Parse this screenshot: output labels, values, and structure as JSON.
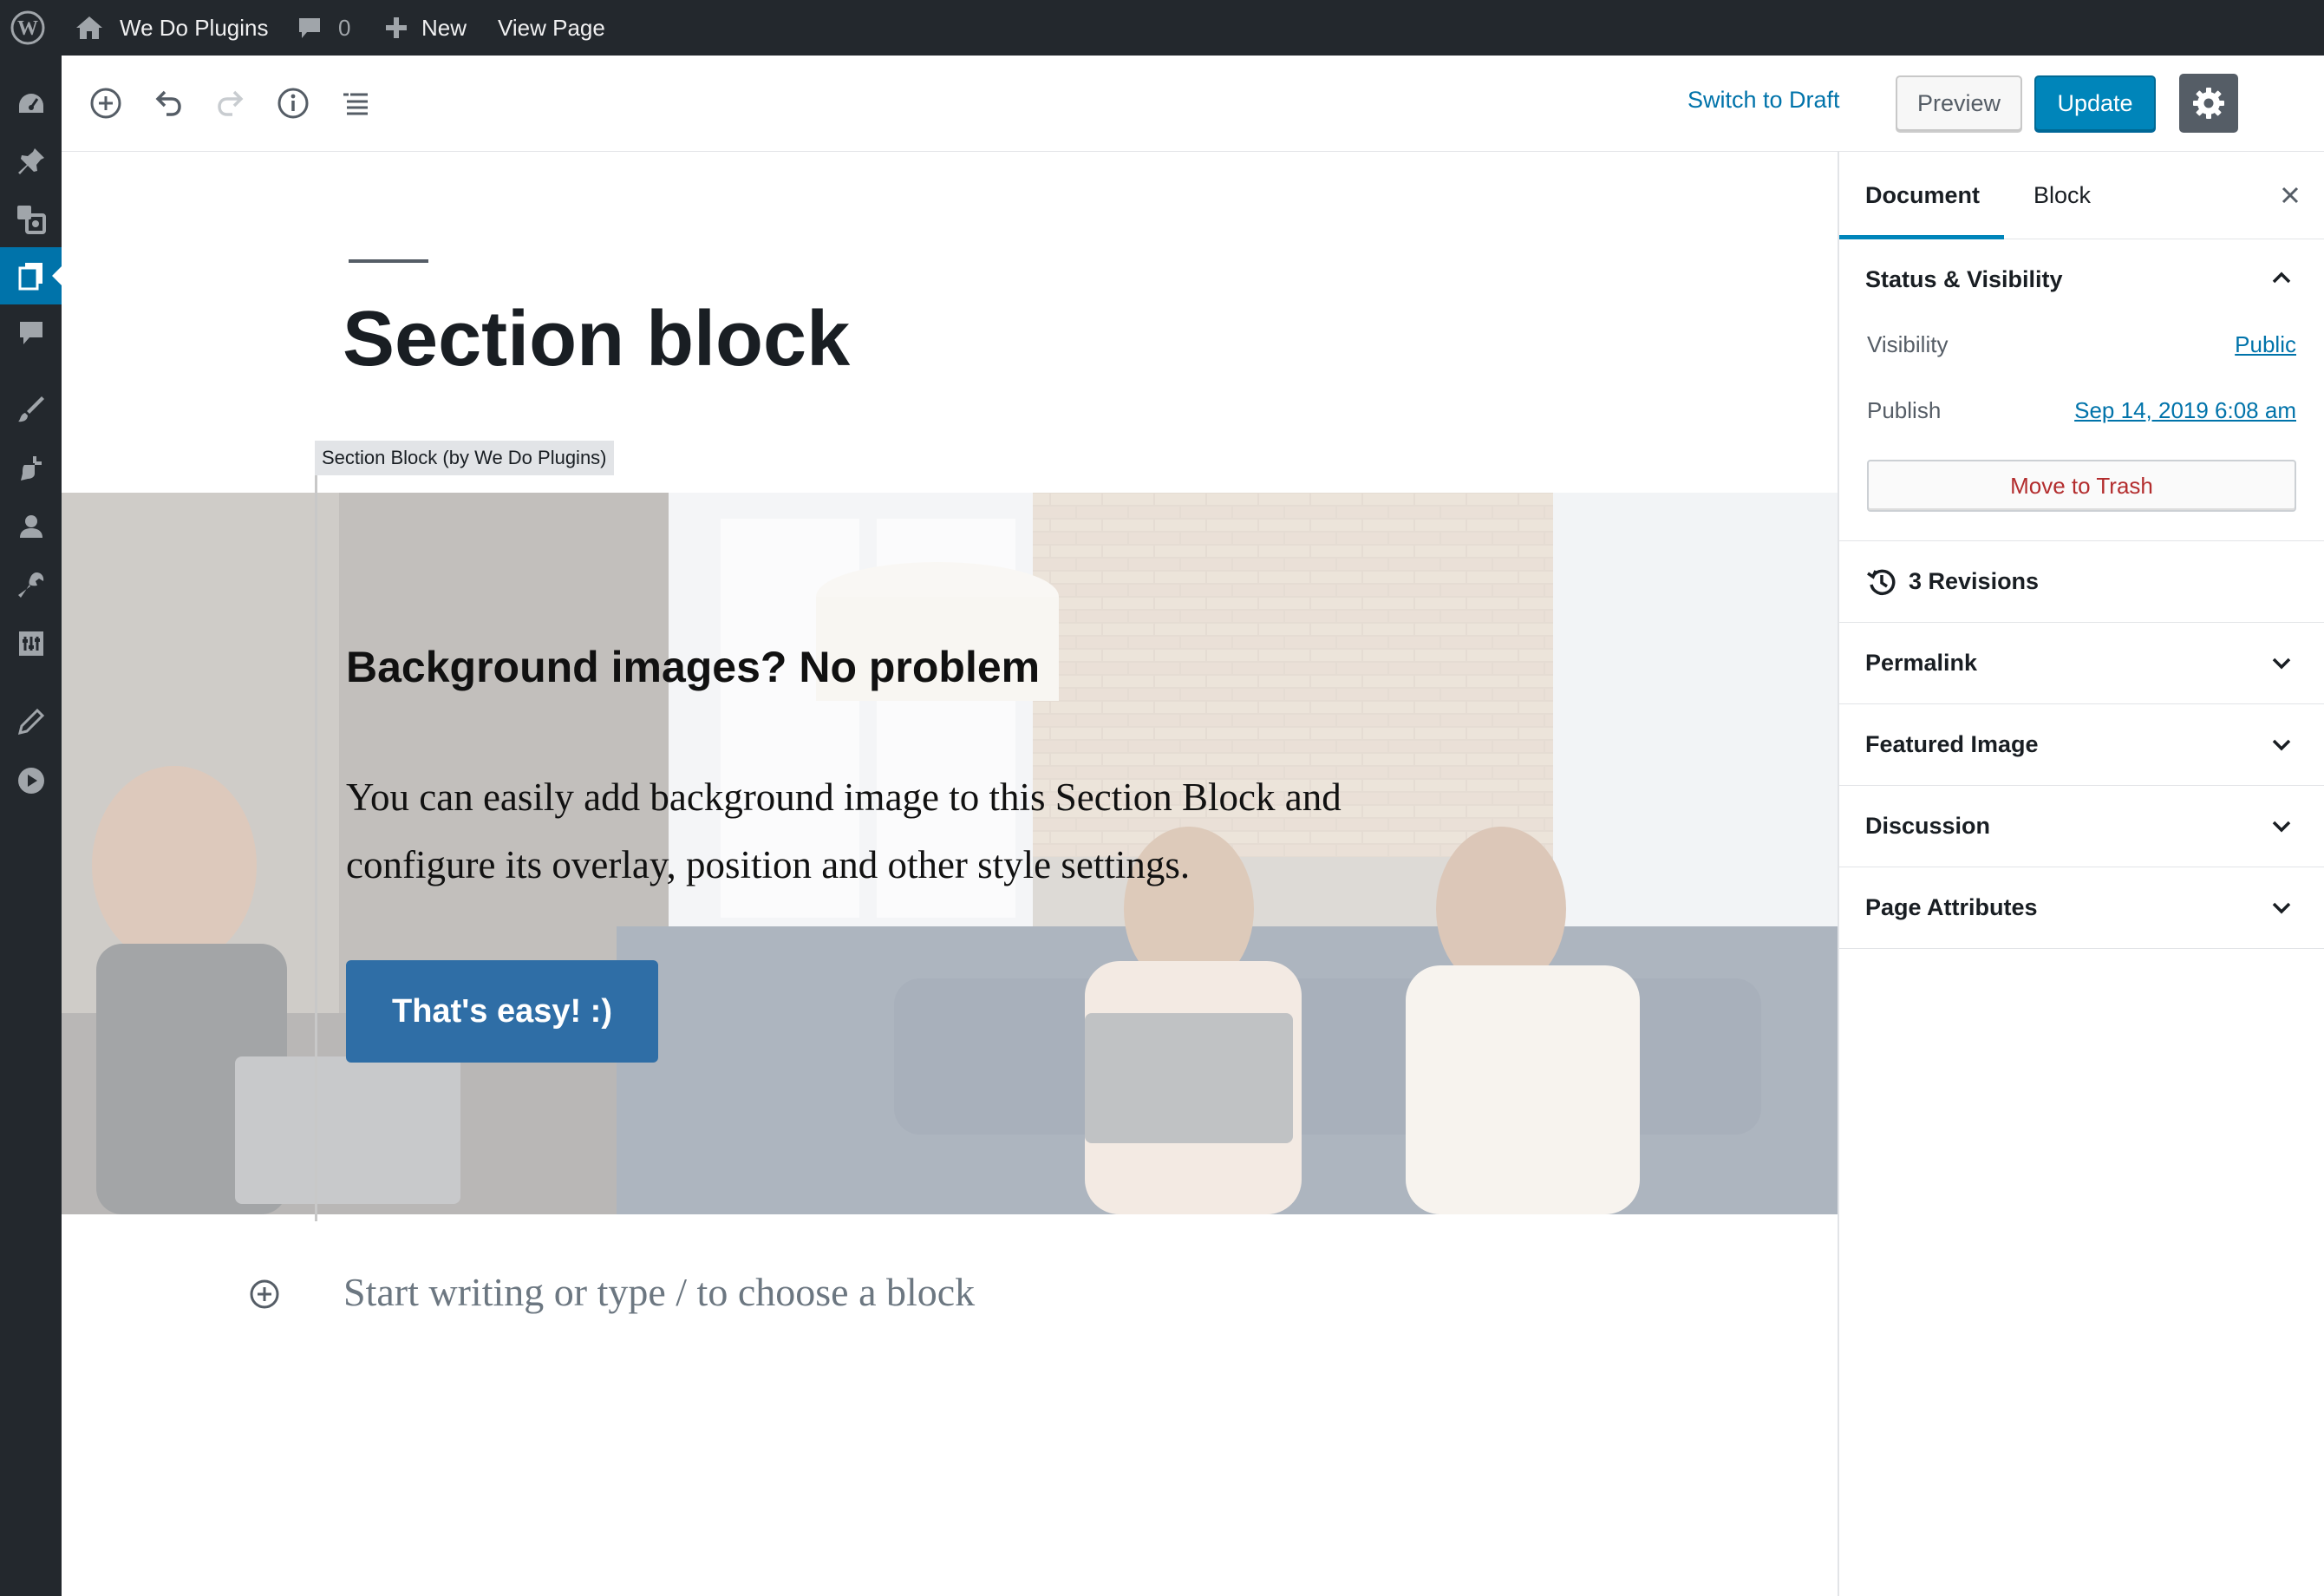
{
  "admin_bar": {
    "site_name": "We Do Plugins",
    "comments_count": "0",
    "new_label": "New",
    "view_page_label": "View Page"
  },
  "header": {
    "switch_to_draft": "Switch to Draft",
    "preview": "Preview",
    "update": "Update"
  },
  "editor": {
    "post_title": "Section block",
    "block_label": "Section Block (by We Do Plugins)",
    "section_heading": "Background images? No problem",
    "section_paragraph": "You can easily add background image to this Section Block and configure its overlay, position and other style settings.",
    "section_button": "That's easy! :)",
    "appender_placeholder": "Start writing or type / to choose a block"
  },
  "sidebar": {
    "tabs": [
      "Document",
      "Block"
    ],
    "status_visibility": {
      "title": "Status & Visibility",
      "visibility_label": "Visibility",
      "visibility_value": "Public",
      "publish_label": "Publish",
      "publish_value": "Sep 14, 2019 6:08 am",
      "trash_label": "Move to Trash"
    },
    "revisions": "3 Revisions",
    "panels": [
      "Permalink",
      "Featured Image",
      "Discussion",
      "Page Attributes"
    ]
  },
  "colors": {
    "admin_dark": "#23282d",
    "accent": "#0085ba",
    "link": "#0073aa",
    "trash": "#b32d2e",
    "section_button": "#2f6ea6"
  }
}
